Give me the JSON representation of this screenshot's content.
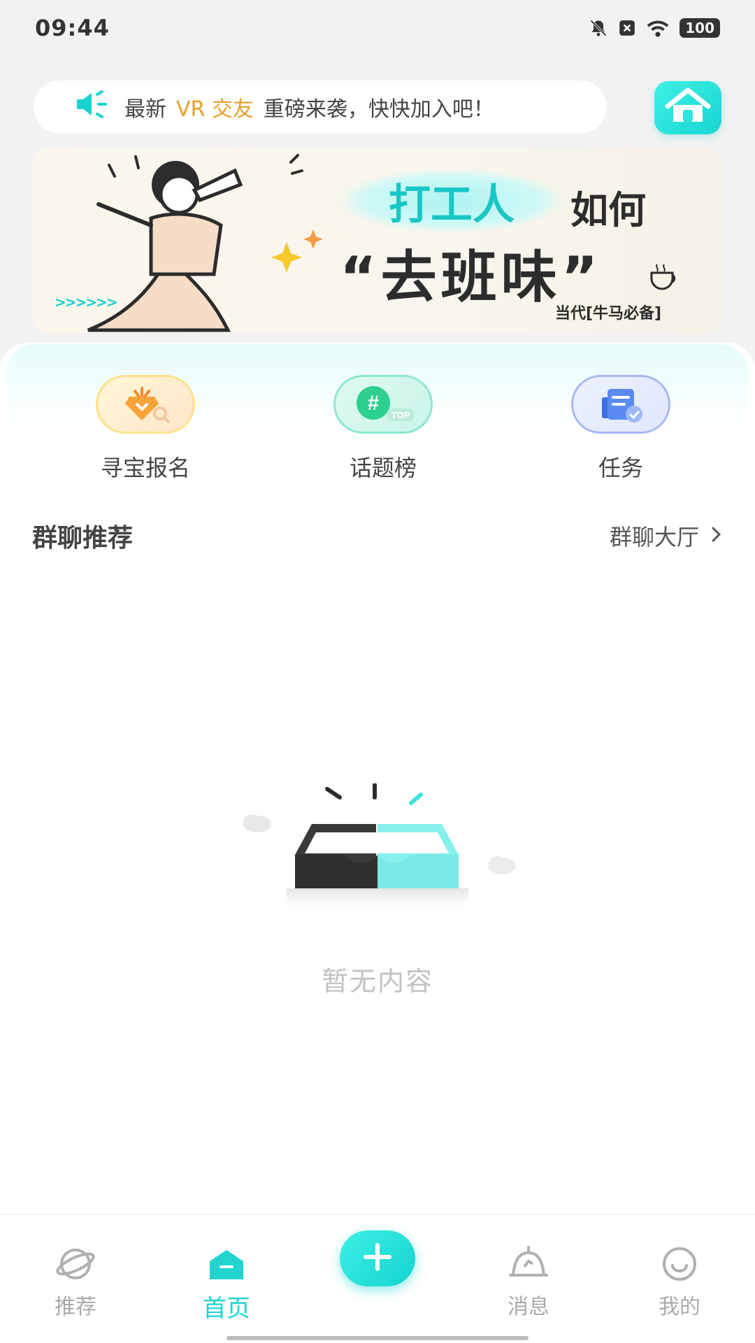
{
  "status_bar": {
    "time": "09:44",
    "battery": "100",
    "icons": [
      "bell-off-icon",
      "close-box-icon",
      "wifi-icon",
      "battery-icon"
    ]
  },
  "notice": {
    "prefix": "最新",
    "highlight": "VR 交友",
    "suffix": "重磅来袭，快快加入吧！",
    "highlight_color": "#e6a12a"
  },
  "banner": {
    "title_part1": "打工人",
    "title_part2": "如何",
    "title_part3": "“去班味”",
    "subtitle": "当代[牛马必备]",
    "arrows": ">>>>>>"
  },
  "quick_actions": [
    {
      "label": "寻宝报名",
      "icon": "treasure-icon"
    },
    {
      "label": "话题榜",
      "icon": "topic-hashtag-icon"
    },
    {
      "label": "任务",
      "icon": "task-icon"
    }
  ],
  "group_section": {
    "title": "群聊推荐",
    "link": "群聊大厅"
  },
  "empty_state": {
    "text": "暂无内容"
  },
  "tabbar": {
    "items": [
      {
        "label": "推荐",
        "icon": "planet-icon"
      },
      {
        "label": "首页",
        "icon": "home-icon"
      },
      {
        "label": "",
        "icon": "plus-icon"
      },
      {
        "label": "消息",
        "icon": "bell-icon"
      },
      {
        "label": "我的",
        "icon": "smile-icon"
      }
    ],
    "active_index": 1
  },
  "colors": {
    "accent": "#21d4d0",
    "highlight": "#e6a12a"
  }
}
